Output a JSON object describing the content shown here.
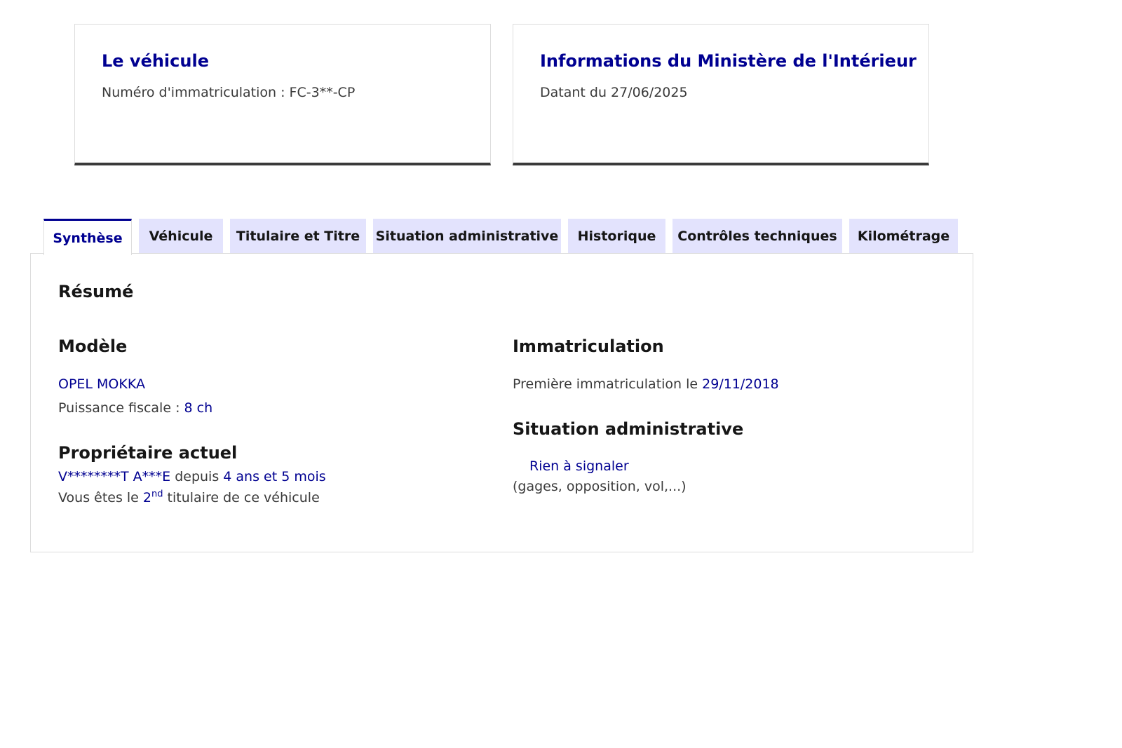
{
  "cards": {
    "vehicle": {
      "title": "Le véhicule",
      "subtitle": "Numéro d'immatriculation : FC-3**-CP"
    },
    "ministry": {
      "title": "Informations du Ministère de l'Intérieur",
      "subtitle": "Datant du 27/06/2025"
    }
  },
  "tabs": [
    {
      "label": "Synthèse",
      "active": true
    },
    {
      "label": "Véhicule",
      "active": false
    },
    {
      "label": "Titulaire et Titre",
      "active": false
    },
    {
      "label": "Situation administrative",
      "active": false
    },
    {
      "label": "Historique",
      "active": false
    },
    {
      "label": "Contrôles techniques",
      "active": false
    },
    {
      "label": "Kilométrage",
      "active": false
    }
  ],
  "summary": {
    "title": "Résumé",
    "model": {
      "heading": "Modèle",
      "name": "OPEL MOKKA",
      "power_label": "Puissance fiscale : ",
      "power_value": "8 ch"
    },
    "owner": {
      "heading": "Propriétaire actuel",
      "name": "V********T A***E",
      "since_label": " depuis ",
      "since_value": "4 ans et 5 mois",
      "rank_prefix": "Vous êtes le ",
      "rank_number": "2",
      "rank_suffix": "nd",
      "rank_after": " titulaire de ce véhicule"
    },
    "registration": {
      "heading": "Immatriculation",
      "first_label": "Première immatriculation le ",
      "first_value": "29/11/2018"
    },
    "admin": {
      "heading": "Situation administrative",
      "status": "Rien à signaler",
      "note": "(gages, opposition, vol,...)"
    }
  },
  "colors": {
    "accent": "#000091",
    "tab_bg": "#e3e3fd",
    "card_border_bottom": "#3a3a3a"
  }
}
